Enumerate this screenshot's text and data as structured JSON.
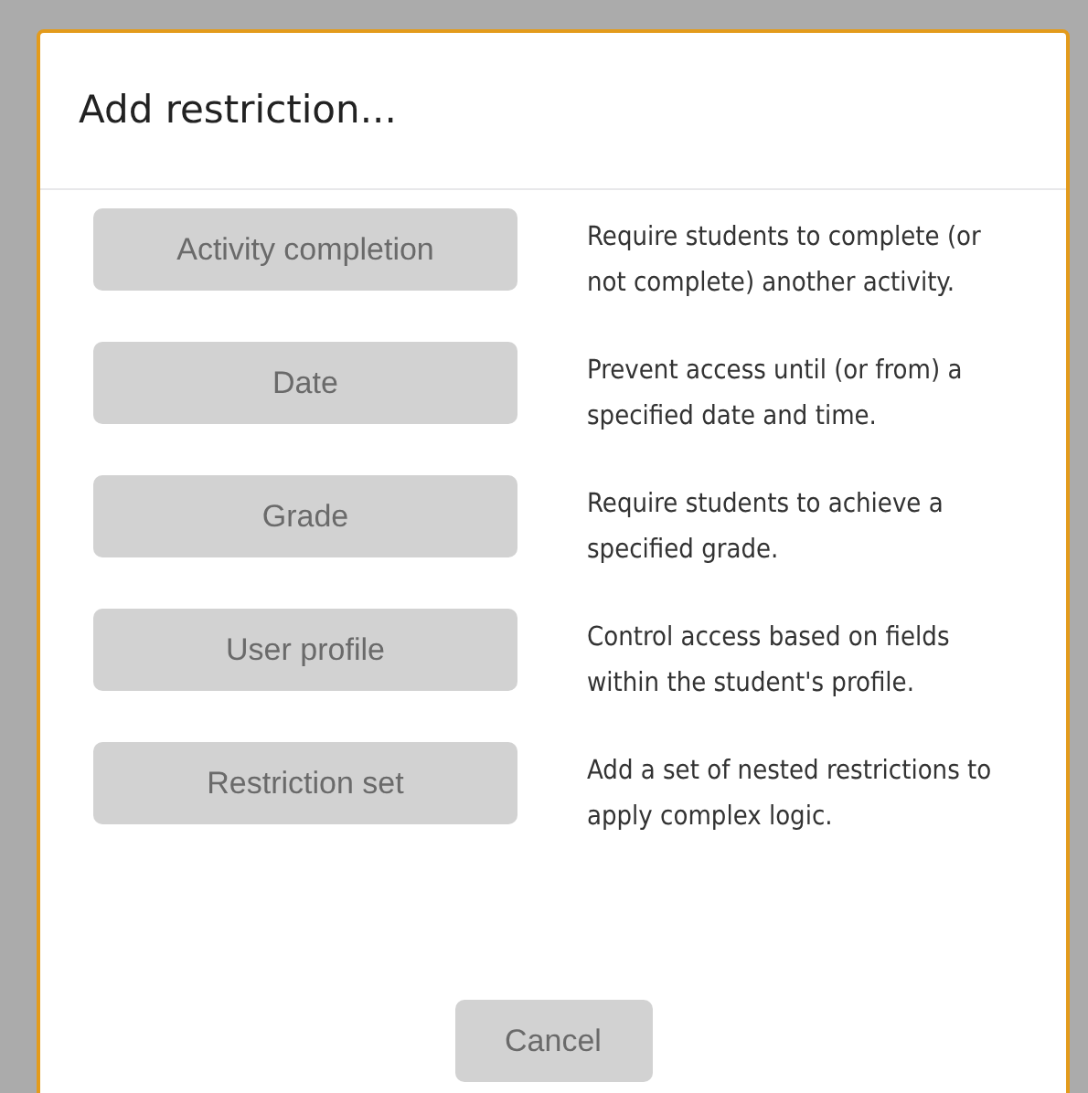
{
  "dialog": {
    "title": "Add restriction...",
    "options": [
      {
        "label": "Activity completion",
        "description": "Require students to complete (or not complete) another activity."
      },
      {
        "label": "Date",
        "description": "Prevent access until (or from) a specified date and time."
      },
      {
        "label": "Grade",
        "description": "Require students to achieve a specified grade."
      },
      {
        "label": "User profile",
        "description": "Control access based on fields within the student's profile."
      },
      {
        "label": "Restriction set",
        "description": "Add a set of nested restrictions to apply complex logic."
      }
    ],
    "cancel": "Cancel"
  }
}
